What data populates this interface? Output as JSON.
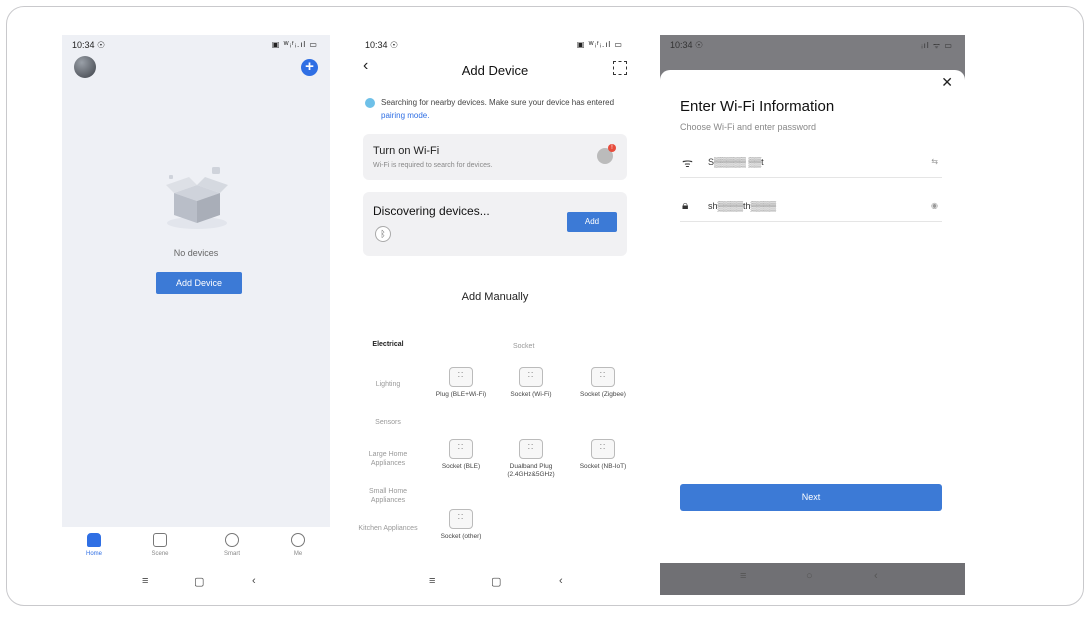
{
  "phone1": {
    "status": {
      "time": "10:34 ☉",
      "icons": "▣ ᵂᵢᶠᵢ.ıl ▭"
    },
    "empty_text": "No devices",
    "add_device_label": "Add Device",
    "tabs": [
      {
        "label": "Home"
      },
      {
        "label": "Scene"
      },
      {
        "label": "Smart"
      },
      {
        "label": "Me"
      }
    ],
    "nav": {
      "menu": "≡",
      "home": "▢",
      "back": "‹"
    }
  },
  "phone2": {
    "status": {
      "time": "10:34 ☉",
      "icons": "▣ ᵂᵢᶠᵢ.ıl ▭"
    },
    "title": "Add Device",
    "search_text": "Searching for nearby devices. Make sure your device has entered",
    "search_link": "pairing mode.",
    "wifi_card": {
      "title": "Turn on Wi-Fi",
      "subtitle": "Wi-Fi is required to search for devices.",
      "badge": "!"
    },
    "discover_card": {
      "title": "Discovering devices...",
      "add_label": "Add"
    },
    "add_manually": "Add Manually",
    "categories": [
      "Electrical",
      "Lighting",
      "Sensors",
      "Large Home Appliances",
      "Small Home Appliances",
      "Kitchen Appliances"
    ],
    "socket_header": "Socket",
    "devices": [
      {
        "label": "Plug (BLE+Wi-Fi)"
      },
      {
        "label": "Socket (Wi-Fi)"
      },
      {
        "label": "Socket (Zigbee)"
      },
      {
        "label": "Socket (BLE)"
      },
      {
        "label": "Dualband Plug (2.4GHz&5GHz)"
      },
      {
        "label": "Socket (NB-IoT)"
      },
      {
        "label": "Socket (other)"
      }
    ],
    "nav": {
      "menu": "≡",
      "home": "▢",
      "back": "‹"
    }
  },
  "phone3": {
    "status": {
      "time": "10:34 ☉",
      "icons": "ᵢıl ᯤ ▭"
    },
    "title": "Enter Wi-Fi Information",
    "subtitle": "Choose Wi-Fi and enter password",
    "ssid": "S▒▒▒▒▒ ▒▒t",
    "password": "sh▒▒▒▒th▒▒▒▒",
    "next_label": "Next",
    "nav": {
      "menu": "≡",
      "home": "○",
      "back": "‹"
    }
  }
}
